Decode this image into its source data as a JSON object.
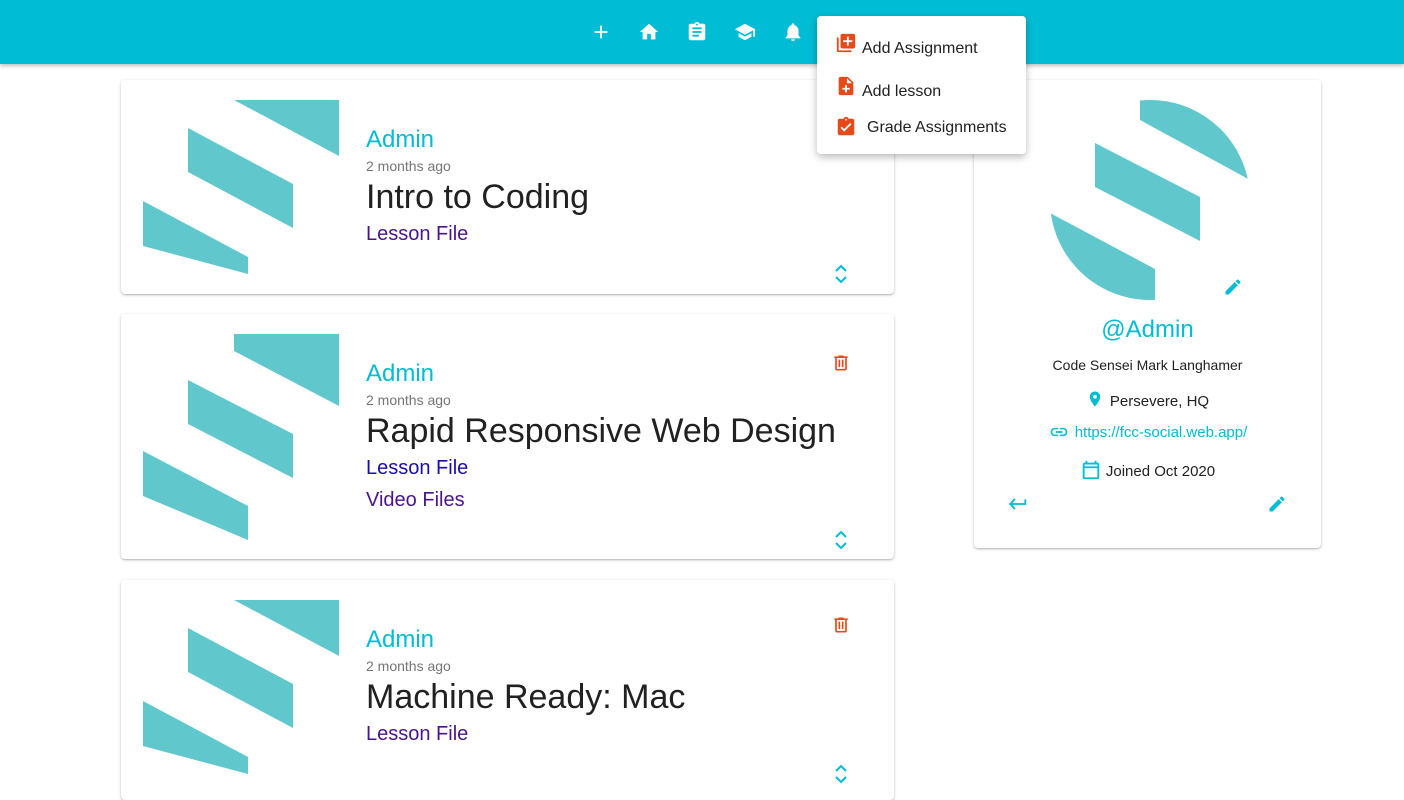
{
  "colors": {
    "primary": "#00bcd4",
    "danger": "#e64a19",
    "link_visited": "#4a148c",
    "link": "#1a0dab"
  },
  "navbar": {
    "items": [
      {
        "icon": "plus-icon"
      },
      {
        "icon": "home-icon"
      },
      {
        "icon": "clipboard-icon"
      },
      {
        "icon": "school-icon"
      },
      {
        "icon": "bell-icon"
      }
    ]
  },
  "menu": {
    "items": [
      {
        "icon": "add-library-icon",
        "label": "Add Assignment"
      },
      {
        "icon": "add-file-icon",
        "label": "Add lesson"
      },
      {
        "icon": "assignment-check-icon",
        "label": "Grade Assignments"
      }
    ]
  },
  "posts": [
    {
      "author": "Admin",
      "time": "2 months ago",
      "title": "Intro to Coding",
      "links": [
        "Lesson File"
      ]
    },
    {
      "author": "Admin",
      "time": "2 months ago",
      "title": "Rapid Responsive Web Design",
      "links": [
        "Lesson File",
        "Video Files"
      ]
    },
    {
      "author": "Admin",
      "time": "2 months ago",
      "title": "Machine Ready: Mac",
      "links": [
        "Lesson File"
      ]
    }
  ],
  "profile": {
    "handle": "@Admin",
    "bio": "Code Sensei Mark Langhamer",
    "location": "Persevere, HQ",
    "website": "https://fcc-social.web.app/",
    "joined": "Joined Oct 2020"
  }
}
